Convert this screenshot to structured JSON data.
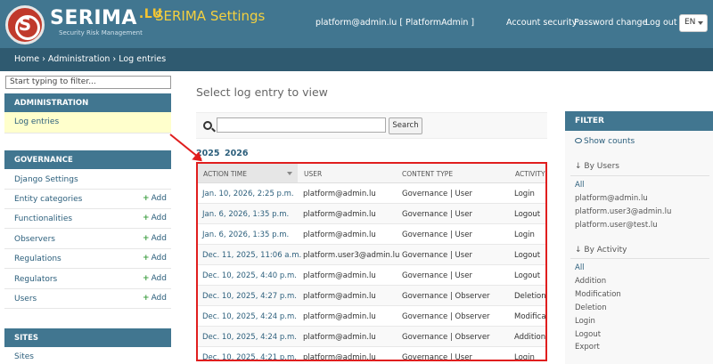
{
  "header": {
    "brand": "SERIMA",
    "brand_suffix": ".LU",
    "logo_letter": "S",
    "tagline": "Security Risk Management",
    "app_title": "SERIMA Settings",
    "user": "platform@admin.lu [ PlatformAdmin ]",
    "links": [
      "Account security",
      "Password change",
      "Log out"
    ],
    "language": "EN"
  },
  "breadcrumbs": "Home › Administration › Log entries",
  "sidebar": {
    "filter_placeholder": "Start typing to filter...",
    "add_label": "Add",
    "admin_caption": "ADMINISTRATION",
    "admin_items": [
      "Log entries"
    ],
    "governance_caption": "GOVERNANCE",
    "governance_items": [
      {
        "label": "Django Settings",
        "add": false
      },
      {
        "label": "Entity categories",
        "add": true
      },
      {
        "label": "Functionalities",
        "add": true
      },
      {
        "label": "Observers",
        "add": true
      },
      {
        "label": "Regulations",
        "add": true
      },
      {
        "label": "Regulators",
        "add": true
      },
      {
        "label": "Users",
        "add": true
      }
    ],
    "sites_caption": "SITES",
    "sites_items": [
      "Sites"
    ]
  },
  "main": {
    "title": "Select log entry to view",
    "search_button": "Search",
    "years": [
      "2025",
      "2026"
    ],
    "columns": [
      "ACTION TIME",
      "USER",
      "CONTENT TYPE",
      "ACTIVITY"
    ],
    "rows": [
      [
        "Jan. 10, 2026, 2:25 p.m.",
        "platform@admin.lu",
        "Governance | User",
        "Login"
      ],
      [
        "Jan. 6, 2026, 1:35 p.m.",
        "platform@admin.lu",
        "Governance | User",
        "Logout"
      ],
      [
        "Jan. 6, 2026, 1:35 p.m.",
        "platform@admin.lu",
        "Governance | User",
        "Login"
      ],
      [
        "Dec. 11, 2025, 11:06 a.m.",
        "platform.user3@admin.lu",
        "Governance | User",
        "Logout"
      ],
      [
        "Dec. 10, 2025, 4:40 p.m.",
        "platform@admin.lu",
        "Governance | User",
        "Logout"
      ],
      [
        "Dec. 10, 2025, 4:27 p.m.",
        "platform@admin.lu",
        "Governance | Observer",
        "Deletion"
      ],
      [
        "Dec. 10, 2025, 4:24 p.m.",
        "platform@admin.lu",
        "Governance | Observer",
        "Modificati"
      ],
      [
        "Dec. 10, 2025, 4:24 p.m.",
        "platform@admin.lu",
        "Governance | Observer",
        "Addition"
      ],
      [
        "Dec. 10, 2025, 4:21 p.m.",
        "platform@admin.lu",
        "Governance | User",
        "Login"
      ]
    ]
  },
  "filter": {
    "title": "FILTER",
    "show_counts": "Show counts",
    "by_users_heading": "↓ By Users",
    "users": [
      "All",
      "platform@admin.lu",
      "platform.user3@admin.lu",
      "platform.user@test.lu"
    ],
    "by_activity_heading": "↓ By Activity",
    "activities": [
      "All",
      "Addition",
      "Modification",
      "Deletion",
      "Login",
      "Logout",
      "Export"
    ]
  },
  "colors": {
    "header": "#417690",
    "breadcrumb": "#2f5a70",
    "accent": "#f4d03f",
    "highlight": "#e01e1e",
    "active_row": "#ffffcc"
  }
}
